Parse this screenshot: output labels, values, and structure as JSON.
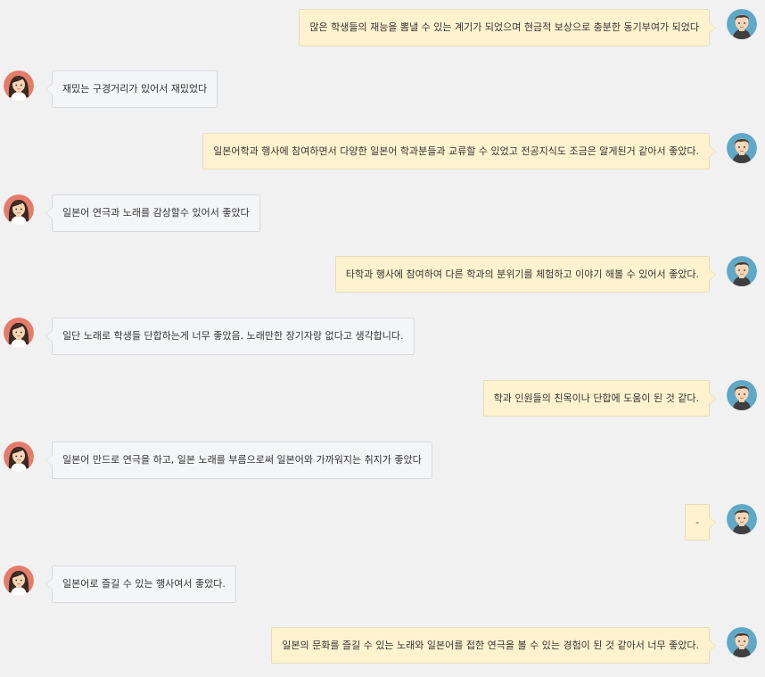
{
  "theme": {
    "background": "#f1f1f1",
    "right_bubble_bg": "#fff3cf",
    "left_bubble_bg": "#f4f5f7",
    "male_avatar_ring": "#5fa8c7",
    "female_avatar_ring": "#e57c6b"
  },
  "messages": [
    {
      "side": "right",
      "avatar": "male-avatar-icon",
      "text": "많은 학생들의 재능을 뽐낼 수 있는 계기가 되었으며 현금적 보상으로 충분한 동기부여가 되었다"
    },
    {
      "side": "left",
      "avatar": "female-avatar-icon",
      "text": "재밌는 구경거리가 있어서 재밌었다"
    },
    {
      "side": "right",
      "avatar": "male-avatar-icon",
      "text": "일본어학과 행사에 참여하면서 다양한 일본어 학과분들과 교류할 수 있었고 전공지식도 조금은 알게된거 같아서 좋았다."
    },
    {
      "side": "left",
      "avatar": "female-avatar-icon",
      "text": "일본어 연극과 노래를 감상할수 있어서 좋았다"
    },
    {
      "side": "right",
      "avatar": "male-avatar-icon",
      "text": "타학과 행사에 참여하여 다른 학과의 분위기를 체험하고 이야기 해볼 수 있어서 좋았다."
    },
    {
      "side": "left",
      "avatar": "female-avatar-icon",
      "text": "일단 노래로 학생들 단합하는게 너무 좋았음. 노래만한 장기자랑 없다고 생각합니다."
    },
    {
      "side": "right",
      "avatar": "male-avatar-icon",
      "text": "학과 인원들의 친목이나 단합에 도움이 된 것 같다."
    },
    {
      "side": "left",
      "avatar": "female-avatar-icon",
      "text": "일본어 만드로 연극을 하고, 일본 노래를 부름으로써 일본어와 가까워지는 취지가 좋았다"
    },
    {
      "side": "right",
      "avatar": "male-avatar-icon",
      "text": "-"
    },
    {
      "side": "left",
      "avatar": "female-avatar-icon",
      "text": "일본어로 즐길 수 있는 행사여서 좋았다."
    },
    {
      "side": "right",
      "avatar": "male-avatar-icon",
      "text": "일본의 문화를 즐길 수 있는 노래와 일본어를 접한 연극을 볼 수 있는 경험이 된 것 같아서 너무 좋았다."
    }
  ]
}
